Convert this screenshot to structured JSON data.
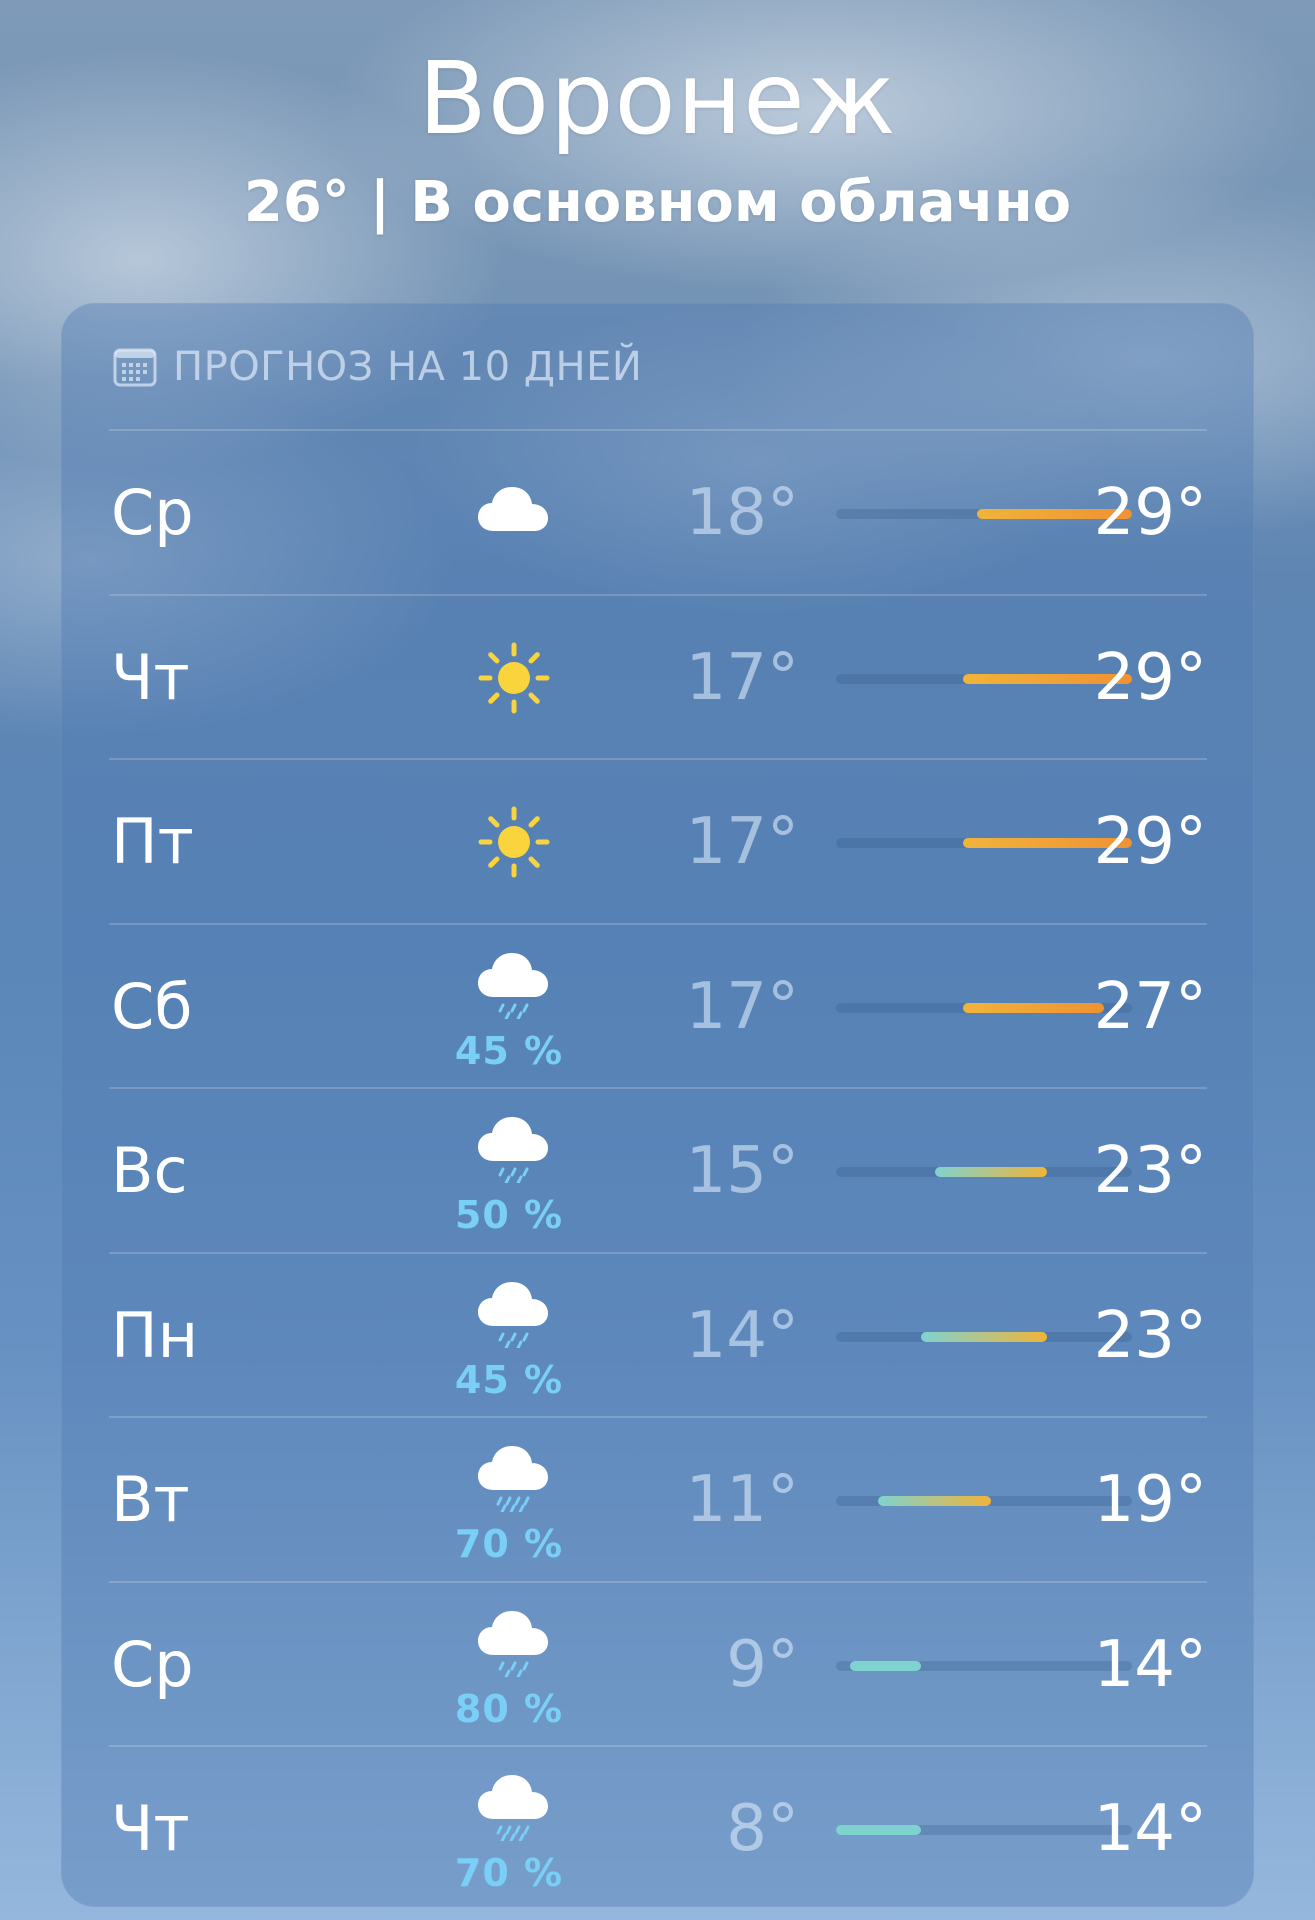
{
  "city": "Воронеж",
  "current_temp": "26°",
  "separator": "|",
  "condition": "В основном облачно",
  "forecast_title": "ПРОГНОЗ НА 10 ДНЕЙ",
  "forecast_icon": "calendar-icon",
  "scale": {
    "min": 8,
    "max": 29
  },
  "colors": {
    "precip": "#79cff5",
    "sun": "#f9d43c",
    "cold": "#7fd3cf",
    "warm": "#f0b43a",
    "hot": "#ef9234"
  },
  "days": [
    {
      "day": "Ср",
      "icon": "cloud-icon",
      "precip": "",
      "low": "18°",
      "high": "29°",
      "low_val": 18,
      "high_val": 29
    },
    {
      "day": "Чт",
      "icon": "sun-icon",
      "precip": "",
      "low": "17°",
      "high": "29°",
      "low_val": 17,
      "high_val": 29
    },
    {
      "day": "Пт",
      "icon": "sun-icon",
      "precip": "",
      "low": "17°",
      "high": "29°",
      "low_val": 17,
      "high_val": 29
    },
    {
      "day": "Сб",
      "icon": "cloud-drizzle-icon",
      "precip": "45 %",
      "low": "17°",
      "high": "27°",
      "low_val": 17,
      "high_val": 27
    },
    {
      "day": "Вс",
      "icon": "cloud-drizzle-icon",
      "precip": "50 %",
      "low": "15°",
      "high": "23°",
      "low_val": 15,
      "high_val": 23
    },
    {
      "day": "Пн",
      "icon": "cloud-drizzle-icon",
      "precip": "45 %",
      "low": "14°",
      "high": "23°",
      "low_val": 14,
      "high_val": 23
    },
    {
      "day": "Вт",
      "icon": "cloud-rain-icon",
      "precip": "70 %",
      "low": "11°",
      "high": "19°",
      "low_val": 11,
      "high_val": 19
    },
    {
      "day": "Ср",
      "icon": "cloud-drizzle-icon",
      "precip": "80 %",
      "low": "9°",
      "high": "14°",
      "low_val": 9,
      "high_val": 14
    },
    {
      "day": "Чт",
      "icon": "cloud-rain-icon",
      "precip": "70 %",
      "low": "8°",
      "high": "14°",
      "low_val": 8,
      "high_val": 14
    }
  ]
}
